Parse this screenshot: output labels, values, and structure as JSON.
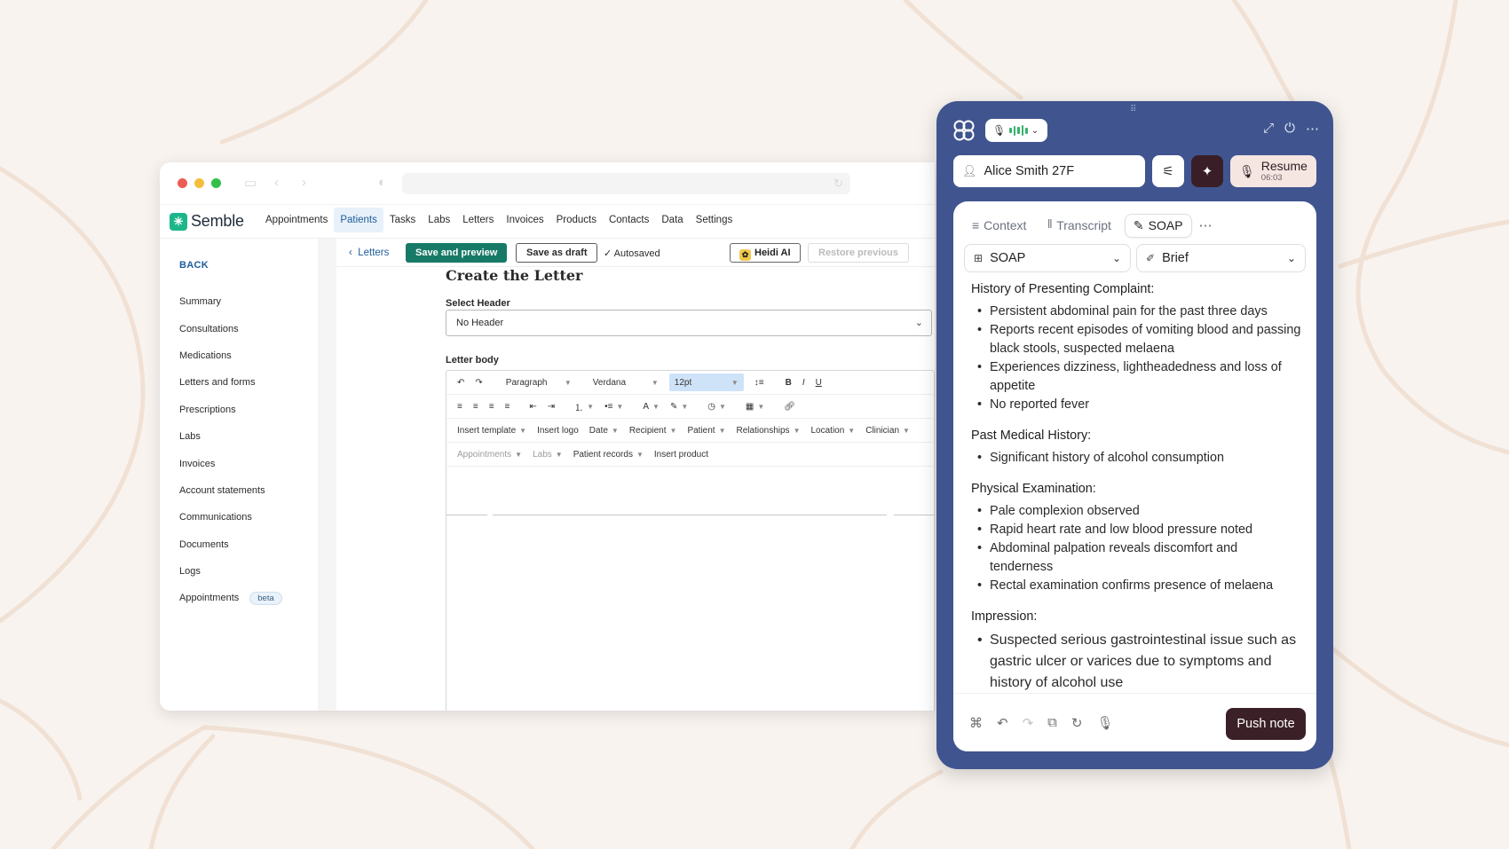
{
  "nav": {
    "brand": "Semble",
    "items": [
      "Appointments",
      "Patients",
      "Tasks",
      "Labs",
      "Letters",
      "Invoices",
      "Products",
      "Contacts",
      "Data",
      "Settings"
    ],
    "active": "Patients"
  },
  "sidebar": {
    "back": "BACK",
    "items": [
      "Summary",
      "Consultations",
      "Medications",
      "Letters and forms",
      "Prescriptions",
      "Labs",
      "Invoices",
      "Account statements",
      "Communications",
      "Documents",
      "Logs",
      "Appointments"
    ],
    "beta_badge": "beta"
  },
  "toolbar": {
    "letters": "Letters",
    "save_preview": "Save and preview",
    "save_draft": "Save as draft",
    "autosaved": "Autosaved",
    "heidi": "Heidi AI",
    "restore": "Restore previous"
  },
  "letter": {
    "title": "Create the Letter",
    "header_label": "Select Header",
    "header_value": "No Header",
    "body_label": "Letter body",
    "paragraph": "Paragraph",
    "font": "Verdana",
    "size": "12pt",
    "insert_row1": [
      "Insert template",
      "Insert logo",
      "Date",
      "Recipient",
      "Patient",
      "Relationships",
      "Location",
      "Clinician"
    ],
    "insert_row2": [
      "Appointments",
      "Labs",
      "Patient records",
      "Insert product"
    ]
  },
  "heidi": {
    "patient": "Alice Smith 27F",
    "resume": "Resume",
    "resume_time": "06:03",
    "tabs": [
      "Context",
      "Transcript",
      "SOAP"
    ],
    "active_tab": "SOAP",
    "template": "SOAP",
    "style": "Brief",
    "push_note": "Push note",
    "sections": [
      {
        "title": "History of Presenting Complaint:",
        "items": [
          "Persistent abdominal pain for the past three days",
          "Reports recent episodes of vomiting blood and passing black stools, suspected melaena",
          "Experiences dizziness, lightheadedness and loss of appetite",
          "No reported fever"
        ]
      },
      {
        "title": "Past Medical History:",
        "items": [
          "Significant history of alcohol consumption"
        ]
      },
      {
        "title": "Physical Examination:",
        "items": [
          "Pale complexion observed",
          "Rapid heart rate and low blood pressure noted",
          "Abdominal palpation reveals discomfort and tenderness",
          "Rectal examination confirms presence of melaena"
        ]
      },
      {
        "title": "Impression:",
        "items": [
          "Suspected serious gastrointestinal issue such as gastric ulcer or varices due to symptoms and history of alcohol use"
        ]
      }
    ]
  }
}
